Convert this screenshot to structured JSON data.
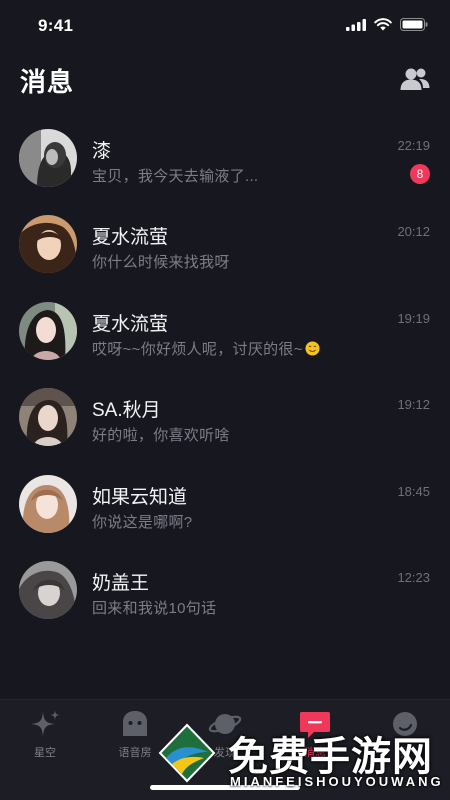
{
  "status_bar": {
    "time": "9:41"
  },
  "header": {
    "title": "消息",
    "contacts_icon": "contacts-icon"
  },
  "conversations": [
    {
      "name": "漆",
      "message": "宝贝，我今天去输液了...",
      "time": "22:19",
      "unread": "8"
    },
    {
      "name": "夏水流萤",
      "message": "你什么时候来找我呀",
      "time": "20:12"
    },
    {
      "name": "夏水流萤",
      "message": "哎呀~~你好烦人呢，讨厌的很~",
      "time": "19:19",
      "emoji": "smiling-emoji-icon"
    },
    {
      "name": "SA.秋月",
      "message": "好的啦，你喜欢听啥",
      "time": "19:12"
    },
    {
      "name": "如果云知道",
      "message": "你说这是哪啊?",
      "time": "18:45"
    },
    {
      "name": "奶盖王",
      "message": "回来和我说10句话",
      "time": "12:23"
    }
  ],
  "tab_bar": {
    "tabs": [
      {
        "label": "星空",
        "icon": "sparkle-icon"
      },
      {
        "label": "语音房",
        "icon": "voice-room-icon"
      },
      {
        "label": "发现",
        "icon": "planet-icon"
      },
      {
        "label": "消息",
        "icon": "message-icon",
        "active": true
      },
      {
        "label": "我",
        "icon": "profile-icon"
      }
    ]
  },
  "watermark": {
    "title": "免费手游网",
    "subtitle": "MIANFEISHOUYOUWANG"
  },
  "colors": {
    "background": "#17181f",
    "accent": "#f0395a",
    "secondary_text": "#7b7d88"
  }
}
